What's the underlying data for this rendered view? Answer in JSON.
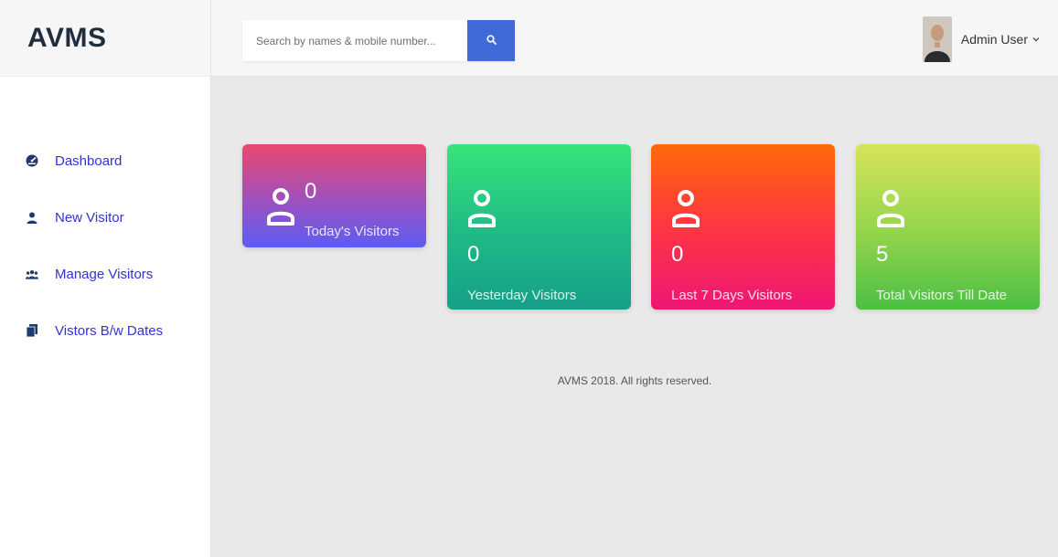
{
  "brand": {
    "title": "AVMS"
  },
  "search": {
    "placeholder": "Search by names & mobile number..."
  },
  "user": {
    "name": "Admin User"
  },
  "sidebar": {
    "items": [
      {
        "label": "Dashboard",
        "icon": "dashboard-icon"
      },
      {
        "label": "New Visitor",
        "icon": "user-icon"
      },
      {
        "label": "Manage Visitors",
        "icon": "users-icon"
      },
      {
        "label": "Vistors B/w Dates",
        "icon": "files-icon"
      }
    ]
  },
  "cards": [
    {
      "count": "0",
      "label": "Today's Visitors"
    },
    {
      "count": "0",
      "label": "Yesterday Visitors"
    },
    {
      "count": "0",
      "label": "Last 7 Days Visitors"
    },
    {
      "count": "5",
      "label": "Total Visitors Till Date"
    }
  ],
  "footer": {
    "text": "AVMS 2018. All rights reserved."
  },
  "colors": {
    "accent": "#3f6ad8",
    "link": "#3131d6"
  }
}
